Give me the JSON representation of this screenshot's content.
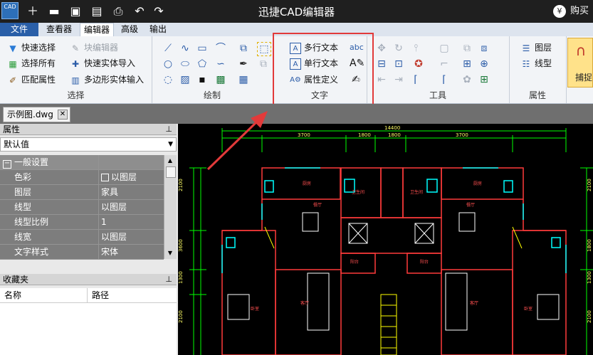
{
  "app": {
    "logo_text": "CAD",
    "title": "迅捷CAD编辑器",
    "buy_label": "购买",
    "buy_icon": "yen-icon"
  },
  "quick_access": [
    "new-icon",
    "open-icon",
    "save-icon",
    "save-as-icon",
    "print-icon",
    "undo-icon",
    "redo-icon"
  ],
  "menu": {
    "file": "文件",
    "items": [
      "查看器",
      "编辑器",
      "高级",
      "输出"
    ],
    "active": "编辑器"
  },
  "ribbon": {
    "select": {
      "label": "选择",
      "quick_select": "快速选择",
      "block_editor": "块编辑器",
      "select_all": "选择所有",
      "quick_entity_import": "快速实体导入",
      "match_properties": "匹配属性",
      "polygon_entity_input": "多边形实体输入"
    },
    "draw": {
      "label": "绘制"
    },
    "text": {
      "label": "文字",
      "mtext": "多行文本",
      "stext": "单行文本",
      "attdef": "属性定义"
    },
    "tools": {
      "label": "工具"
    },
    "properties": {
      "label": "属性",
      "layer": "图层",
      "linetype": "线型",
      "capture": "捕捉"
    }
  },
  "document_tab": {
    "name": "示例图.dwg"
  },
  "properties_panel": {
    "title": "属性",
    "filter": "默认值",
    "section": "一般设置",
    "rows": [
      {
        "name": "色彩",
        "value": "以图层"
      },
      {
        "name": "图层",
        "value": "家具"
      },
      {
        "name": "线型",
        "value": "以图层"
      },
      {
        "name": "线型比例",
        "value": "1"
      },
      {
        "name": "线宽",
        "value": "以图层"
      },
      {
        "name": "文字样式",
        "value": "宋体"
      }
    ]
  },
  "favorites_panel": {
    "title": "收藏夹",
    "col_name": "名称",
    "col_path": "路径"
  },
  "drawing": {
    "dims_top": [
      "14400",
      "3700",
      "1800",
      "1800",
      "3700"
    ],
    "dims_left": [
      "2100",
      "3600",
      "1300",
      "2100"
    ],
    "dims_right": [
      "2100",
      "1800",
      "1300",
      "2100"
    ],
    "rooms": [
      "厨房",
      "厨房",
      "卧室",
      "卧室",
      "客厅",
      "客厅",
      "餐厅",
      "餐厅",
      "卫生间",
      "卫生间",
      "阳台",
      "阳台"
    ],
    "colors": {
      "wall": "#ff3b3b",
      "dim": "#00ff00",
      "fixture": "#00ffff",
      "furniture": "#ffffff",
      "accent": "#ffff00"
    }
  }
}
